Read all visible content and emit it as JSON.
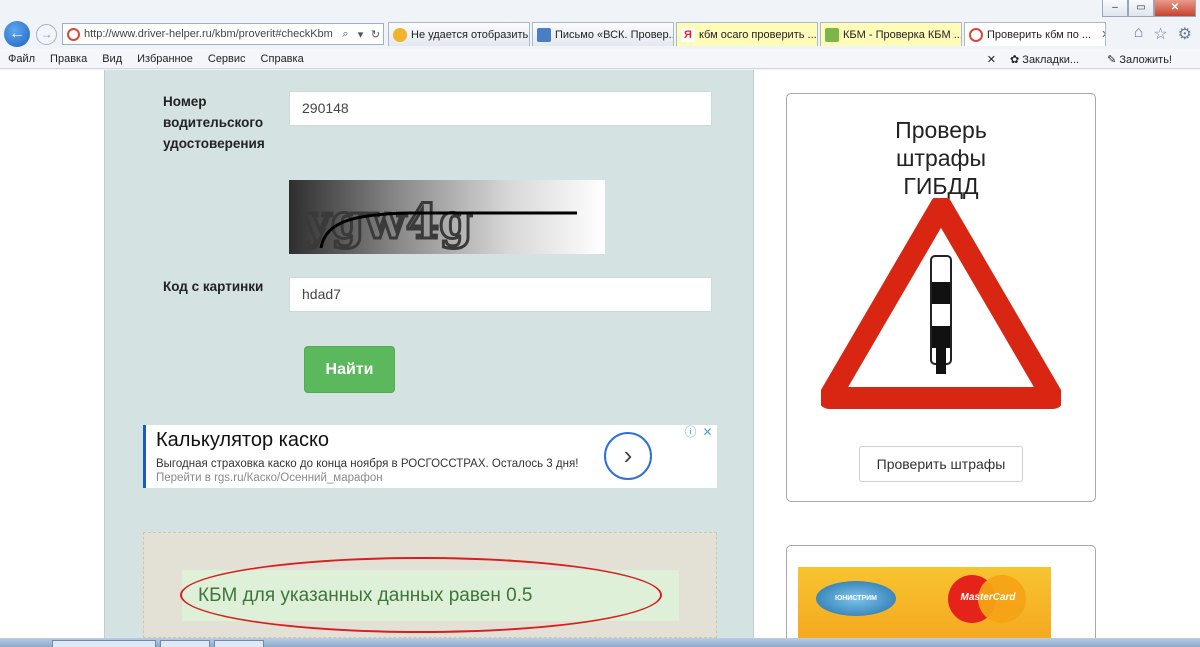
{
  "browser": {
    "address": "http://www.driver-helper.ru/kbm/proverit#checkKbm",
    "tabs": [
      {
        "label": "Не удается отобразить...",
        "icon": "warning-page-icon"
      },
      {
        "label": "Письмо «ВСК. Провер...",
        "icon": "mail-icon"
      },
      {
        "label": "кбм осаго проверить ...",
        "icon": "yandex-icon"
      },
      {
        "label": "КБМ - Проверка КБМ ...",
        "icon": "document-icon"
      },
      {
        "label": "Проверить кбм по ...",
        "icon": "site-icon"
      }
    ],
    "menu": [
      "Файл",
      "Правка",
      "Вид",
      "Избранное",
      "Сервис",
      "Справка"
    ],
    "bookmarks_label": "Закладки...",
    "bookmark_add_label": "Заложить!",
    "window_controls": {
      "minimize": "–",
      "maximize": "▭",
      "close": "✕"
    }
  },
  "form": {
    "license_label": "Номер водительского удостоверения",
    "license_value": "290148",
    "captcha_text": "ygw4g",
    "code_label": "Код с картинки",
    "code_value": "hdad7",
    "submit_label": "Найти"
  },
  "ad": {
    "title": "Калькулятор каско",
    "text": "Выгодная страховка каско до конца ноября в РОСГОССТРАХ. Осталось 3 дня!",
    "link": "Перейти в rgs.ru/Каско/Осенний_марафон"
  },
  "result": {
    "text": "КБМ для указанных данных равен 0.5"
  },
  "sidebar": {
    "title": "Проверь штрафы ГИБДД",
    "button": "Проверить штрафы",
    "banner_left": "ЮНИСТРИМ",
    "banner_right": "MasterCard"
  },
  "colors": {
    "panel": "#d5e2e2",
    "button_green": "#5cb85c",
    "result_bg": "#dff0d8",
    "result_text": "#3c763d",
    "annotation": "#d81e1e"
  }
}
